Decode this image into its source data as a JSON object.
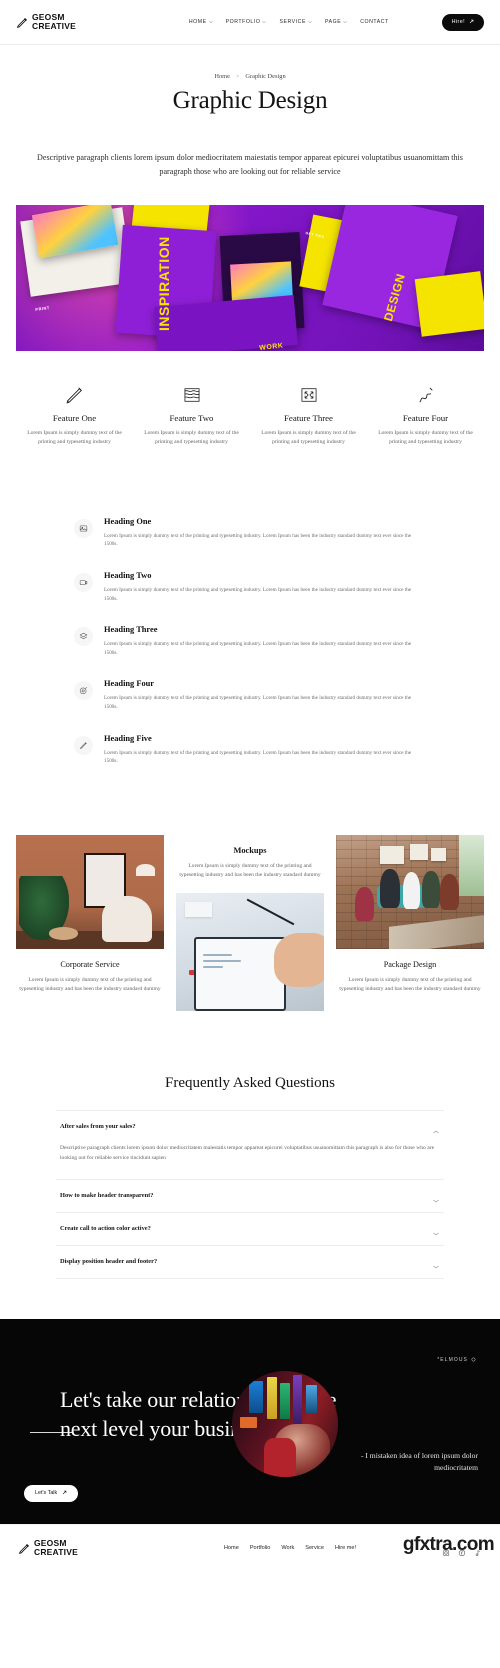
{
  "header": {
    "brand_line1": "GEOSM",
    "brand_line2": "CREATIVE",
    "logo_icon": "pencil-icon",
    "nav": [
      {
        "label": "HOME",
        "has_caret": true
      },
      {
        "label": "PORTFOLIO",
        "has_caret": true
      },
      {
        "label": "SERVICE",
        "has_caret": true
      },
      {
        "label": "PAGE",
        "has_caret": true
      },
      {
        "label": "CONTACT",
        "has_caret": false
      }
    ],
    "cta_label": "Hire!",
    "cta_icon": "arrow-up-right-icon",
    "cta_bg": "#0b0b0b"
  },
  "page": {
    "breadcrumb": {
      "home": "Home",
      "separator": ">",
      "current": "Graphic Design"
    },
    "title": "Graphic Design",
    "lead": "Descriptive paragraph clients lorem ipsum dolor mediocritatem maiestatis tempor appareat epicurei voluptatibus usuanomittam this paragraph those who are looking out for reliable service"
  },
  "hero": {
    "alt": "magazine-mockups-purple-yellow",
    "labels": [
      "INSPIRATION",
      "DESIGN",
      "WORK",
      "GET TIPS",
      "PRINT"
    ],
    "accent_purple": "#8b18cf",
    "accent_yellow": "#f5e400"
  },
  "features": [
    {
      "icon": "pencil-icon",
      "title": "Feature One",
      "text": "Lorem Ipsum is simply dummy text of the printing and typesetting industry"
    },
    {
      "icon": "layers-wave-icon",
      "title": "Feature Two",
      "text": "Lorem Ipsum is simply dummy text of the printing and typesetting industry"
    },
    {
      "icon": "resize-icon",
      "title": "Feature Three",
      "text": "Lorem Ipsum is simply dummy text of the printing and typesetting industry"
    },
    {
      "icon": "squiggle-icon",
      "title": "Feature Four",
      "text": "Lorem Ipsum is simply dummy text of the printing and typesetting industry"
    }
  ],
  "headings": [
    {
      "icon": "image-icon",
      "title": "Heading One",
      "text": "Lorem Ipsum is simply dummy text of the printing and typesetting industry. Lorem Ipsum has been the industry standard dummy text ever since the 1500s."
    },
    {
      "icon": "camera-icon",
      "title": "Heading Two",
      "text": "Lorem Ipsum is simply dummy text of the printing and typesetting industry. Lorem Ipsum has been the industry standard dummy text ever since the 1500s."
    },
    {
      "icon": "layers-icon",
      "title": "Heading Three",
      "text": "Lorem Ipsum is simply dummy text of the printing and typesetting industry. Lorem Ipsum has been the industry standard dummy text ever since the 1500s."
    },
    {
      "icon": "target-icon",
      "title": "Heading Four",
      "text": "Lorem Ipsum is simply dummy text of the printing and typesetting industry. Lorem Ipsum has been the industry standard dummy text ever since the 1500s."
    },
    {
      "icon": "pen-icon",
      "title": "Heading Five",
      "text": "Lorem Ipsum is simply dummy text of the printing and typesetting industry. Lorem Ipsum has been the industry standard dummy text ever since the 1500s."
    }
  ],
  "services": {
    "left": {
      "caption": "Corporate Service",
      "text": "Lorem Ipsum is simply dummy text of the printing and typesetting industry and has been the industry standard dummy",
      "image_alt": "interior-frame-mockup"
    },
    "middle": {
      "caption": "Mockups",
      "text": "Lorem Ipsum is simply dummy text of the printing and typesetting industry and has been the industry standard dummy",
      "image_alt": "tablet-in-hands-mockup"
    },
    "right": {
      "caption": "Package Design",
      "text": "Lorem Ipsum is simply dummy text of the printing and typesetting industry and has been the industry standard dummy",
      "image_alt": "team-celebrating-office"
    }
  },
  "faq": {
    "title": "Frequently Asked Questions",
    "items": [
      {
        "question": "After sales from your sales?",
        "open": true,
        "icon": "chevron-up-icon",
        "answer": "Descriptive paragraph clients lorem ipsum dolor mediocritatem maiestatis tempor appareat epicurei voluptatibus usuanomittam this paragraph is also for those who are looking out for reliable service tincidunt sapien"
      },
      {
        "question": "How to make header transparent?",
        "open": false,
        "icon": "chevron-down-icon",
        "answer": ""
      },
      {
        "question": "Create call to action color active?",
        "open": false,
        "icon": "chevron-down-icon",
        "answer": ""
      },
      {
        "question": "Display position header and footer?",
        "open": false,
        "icon": "chevron-down-icon",
        "answer": ""
      }
    ]
  },
  "cta": {
    "badge": "*ELMOUS",
    "badge_icon": "asterisk-icon",
    "heading": "Let's take our relationship to the next level your business",
    "quote": "- I mistaken idea of lorem ipsum dolor mediocritatem",
    "button_label": "Let's Talk",
    "button_icon": "arrow-up-right-icon",
    "image_alt": "neon-street-portrait",
    "bg": "#060606"
  },
  "footer": {
    "brand_line1": "GEOSM",
    "brand_line2": "CREATIVE",
    "logo_icon": "pencil-icon",
    "nav": [
      "Home",
      "Portfolio",
      "Work",
      "Service",
      "Hire me!"
    ],
    "socials": [
      "instagram-icon",
      "facebook-icon",
      "music-note-icon"
    ],
    "watermark": "gfxtra",
    "watermark_suffix": ".com"
  }
}
